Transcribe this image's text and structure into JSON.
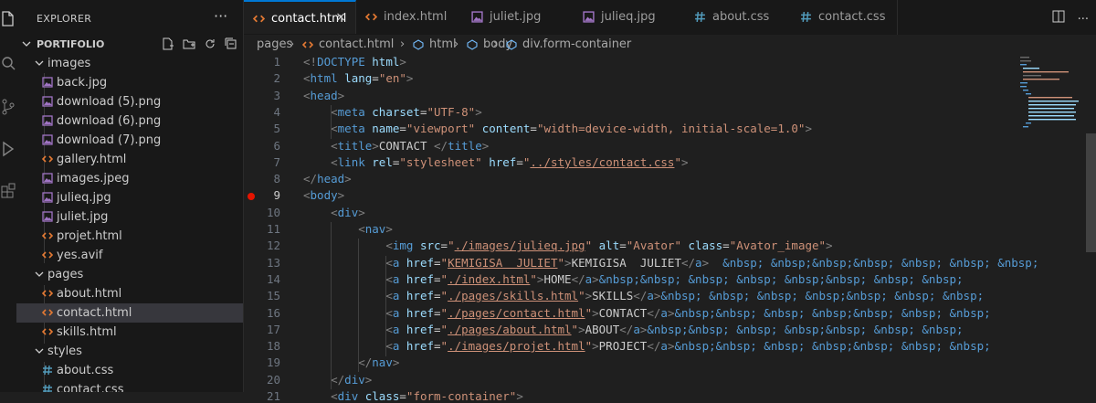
{
  "activity_bar": {
    "icons": [
      "files-icon",
      "search-icon",
      "source-control-icon",
      "run-debug-icon",
      "extensions-icon"
    ]
  },
  "explorer": {
    "title": "EXPLORER",
    "more": "···",
    "root": "PORTIFOLIO",
    "tree": [
      {
        "label": "images",
        "kind": "folder",
        "depth": 1
      },
      {
        "label": "back.jpg",
        "kind": "image",
        "depth": 2
      },
      {
        "label": "download (5).png",
        "kind": "image",
        "depth": 2
      },
      {
        "label": "download (6).png",
        "kind": "image",
        "depth": 2
      },
      {
        "label": "download (7).png",
        "kind": "image",
        "depth": 2
      },
      {
        "label": "gallery.html",
        "kind": "html",
        "depth": 2
      },
      {
        "label": "images.jpeg",
        "kind": "image",
        "depth": 2
      },
      {
        "label": "julieq.jpg",
        "kind": "image",
        "depth": 2
      },
      {
        "label": "juliet.jpg",
        "kind": "image",
        "depth": 2
      },
      {
        "label": "projet.html",
        "kind": "html",
        "depth": 2
      },
      {
        "label": "yes.avif",
        "kind": "html",
        "depth": 2
      },
      {
        "label": "pages",
        "kind": "folder",
        "depth": 1
      },
      {
        "label": "about.html",
        "kind": "html",
        "depth": 2
      },
      {
        "label": "contact.html",
        "kind": "html",
        "depth": 2,
        "selected": true
      },
      {
        "label": "skills.html",
        "kind": "html",
        "depth": 2
      },
      {
        "label": "styles",
        "kind": "folder",
        "depth": 1
      },
      {
        "label": "about.css",
        "kind": "css",
        "depth": 2
      },
      {
        "label": "contact.css",
        "kind": "css",
        "depth": 2
      }
    ]
  },
  "tabs": [
    {
      "label": "contact.html",
      "kind": "html",
      "active": true,
      "close": "×"
    },
    {
      "label": "index.html",
      "kind": "html"
    },
    {
      "label": "juliet.jpg",
      "kind": "image"
    },
    {
      "label": "julieq.jpg",
      "kind": "image"
    },
    {
      "label": "about.css",
      "kind": "css"
    },
    {
      "label": "contact.css",
      "kind": "css"
    }
  ],
  "tab_actions": {
    "split": "▯▯",
    "more": "···"
  },
  "breadcrumb": [
    "pages",
    "contact.html",
    "html",
    "body",
    "div.form-container"
  ],
  "colors": {
    "accent": "#0078d4",
    "html_icon": "#e37933",
    "css_icon": "#519aba",
    "image_icon": "#a074c4",
    "breakpoint": "#e51400"
  },
  "editor": {
    "active_line": 9,
    "breakpoint_line": 9,
    "lines": [
      [
        [
          "t-br",
          "<!"
        ],
        [
          "t-tag",
          "DOCTYPE"
        ],
        [
          "t-txt",
          " "
        ],
        [
          "t-attr",
          "html"
        ],
        [
          "t-br",
          ">"
        ]
      ],
      [
        [
          "t-br",
          "<"
        ],
        [
          "t-tag",
          "html"
        ],
        [
          "t-txt",
          " "
        ],
        [
          "t-attr",
          "lang"
        ],
        [
          "t-txt",
          "="
        ],
        [
          "t-str",
          "\"en\""
        ],
        [
          "t-br",
          ">"
        ]
      ],
      [
        [
          "t-br",
          "<"
        ],
        [
          "t-tag",
          "head"
        ],
        [
          "t-br",
          ">"
        ]
      ],
      [
        [
          "t-txt",
          "    "
        ],
        [
          "t-br",
          "<"
        ],
        [
          "t-tag",
          "meta"
        ],
        [
          "t-txt",
          " "
        ],
        [
          "t-attr",
          "charset"
        ],
        [
          "t-txt",
          "="
        ],
        [
          "t-str",
          "\"UTF-8\""
        ],
        [
          "t-br",
          ">"
        ]
      ],
      [
        [
          "t-txt",
          "    "
        ],
        [
          "t-br",
          "<"
        ],
        [
          "t-tag",
          "meta"
        ],
        [
          "t-txt",
          " "
        ],
        [
          "t-attr",
          "name"
        ],
        [
          "t-txt",
          "="
        ],
        [
          "t-str",
          "\"viewport\""
        ],
        [
          "t-txt",
          " "
        ],
        [
          "t-attr",
          "content"
        ],
        [
          "t-txt",
          "="
        ],
        [
          "t-str",
          "\"width=device-width, initial-scale=1.0\""
        ],
        [
          "t-br",
          ">"
        ]
      ],
      [
        [
          "t-txt",
          "    "
        ],
        [
          "t-br",
          "<"
        ],
        [
          "t-tag",
          "title"
        ],
        [
          "t-br",
          ">"
        ],
        [
          "t-txt",
          "CONTACT "
        ],
        [
          "t-br",
          "</"
        ],
        [
          "t-tag",
          "title"
        ],
        [
          "t-br",
          ">"
        ]
      ],
      [
        [
          "t-txt",
          "    "
        ],
        [
          "t-br",
          "<"
        ],
        [
          "t-tag",
          "link"
        ],
        [
          "t-txt",
          " "
        ],
        [
          "t-attr",
          "rel"
        ],
        [
          "t-txt",
          "="
        ],
        [
          "t-str",
          "\"stylesheet\""
        ],
        [
          "t-txt",
          " "
        ],
        [
          "t-attr",
          "href"
        ],
        [
          "t-txt",
          "="
        ],
        [
          "t-str",
          "\""
        ],
        [
          "t-str t-link",
          "../styles/contact.css"
        ],
        [
          "t-str",
          "\""
        ],
        [
          "t-br",
          ">"
        ]
      ],
      [
        [
          "t-br",
          "</"
        ],
        [
          "t-tag",
          "head"
        ],
        [
          "t-br",
          ">"
        ]
      ],
      [
        [
          "t-br",
          "<"
        ],
        [
          "t-tag",
          "body"
        ],
        [
          "t-br",
          ">"
        ]
      ],
      [
        [
          "t-txt",
          "    "
        ],
        [
          "t-br",
          "<"
        ],
        [
          "t-tag",
          "div"
        ],
        [
          "t-br",
          ">"
        ]
      ],
      [
        [
          "t-txt",
          "        "
        ],
        [
          "t-br",
          "<"
        ],
        [
          "t-tag",
          "nav"
        ],
        [
          "t-br",
          ">"
        ]
      ],
      [
        [
          "t-txt",
          "            "
        ],
        [
          "t-br",
          "<"
        ],
        [
          "t-tag",
          "img"
        ],
        [
          "t-txt",
          " "
        ],
        [
          "t-attr",
          "src"
        ],
        [
          "t-txt",
          "="
        ],
        [
          "t-str",
          "\""
        ],
        [
          "t-str t-link",
          "./images/julieq.jpg"
        ],
        [
          "t-str",
          "\""
        ],
        [
          "t-txt",
          " "
        ],
        [
          "t-attr",
          "alt"
        ],
        [
          "t-txt",
          "="
        ],
        [
          "t-str",
          "\"Avator\""
        ],
        [
          "t-txt",
          " "
        ],
        [
          "t-attr",
          "class"
        ],
        [
          "t-txt",
          "="
        ],
        [
          "t-str",
          "\"Avator_image\""
        ],
        [
          "t-br",
          ">"
        ]
      ],
      [
        [
          "t-txt",
          "            "
        ],
        [
          "t-br",
          "<"
        ],
        [
          "t-tag",
          "a"
        ],
        [
          "t-txt",
          " "
        ],
        [
          "t-attr",
          "href"
        ],
        [
          "t-txt",
          "="
        ],
        [
          "t-str",
          "\""
        ],
        [
          "t-str t-link",
          "KEMIGISA  JULIET"
        ],
        [
          "t-str",
          "\""
        ],
        [
          "t-br",
          ">"
        ],
        [
          "t-txt",
          "KEMIGISA  JULIET"
        ],
        [
          "t-br",
          "</"
        ],
        [
          "t-tag",
          "a"
        ],
        [
          "t-br",
          ">"
        ],
        [
          "t-txt",
          "  "
        ],
        [
          "t-ent",
          "&nbsp; &nbsp;&nbsp;&nbsp; &nbsp; &nbsp; &nbsp;"
        ]
      ],
      [
        [
          "t-txt",
          "            "
        ],
        [
          "t-br",
          "<"
        ],
        [
          "t-tag",
          "a"
        ],
        [
          "t-txt",
          " "
        ],
        [
          "t-attr",
          "href"
        ],
        [
          "t-txt",
          "="
        ],
        [
          "t-str",
          "\""
        ],
        [
          "t-str t-link",
          "./index.html"
        ],
        [
          "t-str",
          "\""
        ],
        [
          "t-br",
          ">"
        ],
        [
          "t-txt",
          "HOME"
        ],
        [
          "t-br",
          "</"
        ],
        [
          "t-tag",
          "a"
        ],
        [
          "t-br",
          ">"
        ],
        [
          "t-ent",
          "&nbsp;&nbsp; &nbsp; &nbsp; &nbsp;&nbsp; &nbsp; &nbsp;"
        ]
      ],
      [
        [
          "t-txt",
          "            "
        ],
        [
          "t-br",
          "<"
        ],
        [
          "t-tag",
          "a"
        ],
        [
          "t-txt",
          " "
        ],
        [
          "t-attr",
          "href"
        ],
        [
          "t-txt",
          "="
        ],
        [
          "t-str",
          "\""
        ],
        [
          "t-str t-link",
          "./pages/skills.html"
        ],
        [
          "t-str",
          "\""
        ],
        [
          "t-br",
          ">"
        ],
        [
          "t-txt",
          "SKILLS"
        ],
        [
          "t-br",
          "</"
        ],
        [
          "t-tag",
          "a"
        ],
        [
          "t-br",
          ">"
        ],
        [
          "t-ent",
          "&nbsp; &nbsp; &nbsp; &nbsp;&nbsp; &nbsp; &nbsp;"
        ]
      ],
      [
        [
          "t-txt",
          "            "
        ],
        [
          "t-br",
          "<"
        ],
        [
          "t-tag",
          "a"
        ],
        [
          "t-txt",
          " "
        ],
        [
          "t-attr",
          "href"
        ],
        [
          "t-txt",
          "="
        ],
        [
          "t-str",
          "\""
        ],
        [
          "t-str t-link",
          "./pages/contact.html"
        ],
        [
          "t-str",
          "\""
        ],
        [
          "t-br",
          ">"
        ],
        [
          "t-txt",
          "CONTACT"
        ],
        [
          "t-br",
          "</"
        ],
        [
          "t-tag",
          "a"
        ],
        [
          "t-br",
          ">"
        ],
        [
          "t-ent",
          "&nbsp;&nbsp; &nbsp; &nbsp;&nbsp; &nbsp; &nbsp;"
        ]
      ],
      [
        [
          "t-txt",
          "            "
        ],
        [
          "t-br",
          "<"
        ],
        [
          "t-tag",
          "a"
        ],
        [
          "t-txt",
          " "
        ],
        [
          "t-attr",
          "href"
        ],
        [
          "t-txt",
          "="
        ],
        [
          "t-str",
          "\""
        ],
        [
          "t-str t-link",
          "./pages/about.html"
        ],
        [
          "t-str",
          "\""
        ],
        [
          "t-br",
          ">"
        ],
        [
          "t-txt",
          "ABOUT"
        ],
        [
          "t-br",
          "</"
        ],
        [
          "t-tag",
          "a"
        ],
        [
          "t-br",
          ">"
        ],
        [
          "t-ent",
          "&nbsp;&nbsp; &nbsp; &nbsp;&nbsp; &nbsp; &nbsp;"
        ]
      ],
      [
        [
          "t-txt",
          "            "
        ],
        [
          "t-br",
          "<"
        ],
        [
          "t-tag",
          "a"
        ],
        [
          "t-txt",
          " "
        ],
        [
          "t-attr",
          "href"
        ],
        [
          "t-txt",
          "="
        ],
        [
          "t-str",
          "\""
        ],
        [
          "t-str t-link",
          "./images/projet.html"
        ],
        [
          "t-str",
          "\""
        ],
        [
          "t-br",
          ">"
        ],
        [
          "t-txt",
          "PROJECT"
        ],
        [
          "t-br",
          "</"
        ],
        [
          "t-tag",
          "a"
        ],
        [
          "t-br",
          ">"
        ],
        [
          "t-ent",
          "&nbsp;&nbsp; &nbsp; &nbsp;&nbsp; &nbsp; &nbsp;"
        ]
      ],
      [
        [
          "t-txt",
          "        "
        ],
        [
          "t-br",
          "</"
        ],
        [
          "t-tag",
          "nav"
        ],
        [
          "t-br",
          ">"
        ]
      ],
      [
        [
          "t-txt",
          "    "
        ],
        [
          "t-br",
          "</"
        ],
        [
          "t-tag",
          "div"
        ],
        [
          "t-br",
          ">"
        ]
      ],
      [
        [
          "t-txt",
          "    "
        ],
        [
          "t-br",
          "<"
        ],
        [
          "t-tag",
          "div"
        ],
        [
          "t-txt",
          " "
        ],
        [
          "t-attr",
          "class"
        ],
        [
          "t-txt",
          "="
        ],
        [
          "t-str",
          "\"form-container\""
        ],
        [
          "t-br",
          ">"
        ]
      ]
    ]
  }
}
